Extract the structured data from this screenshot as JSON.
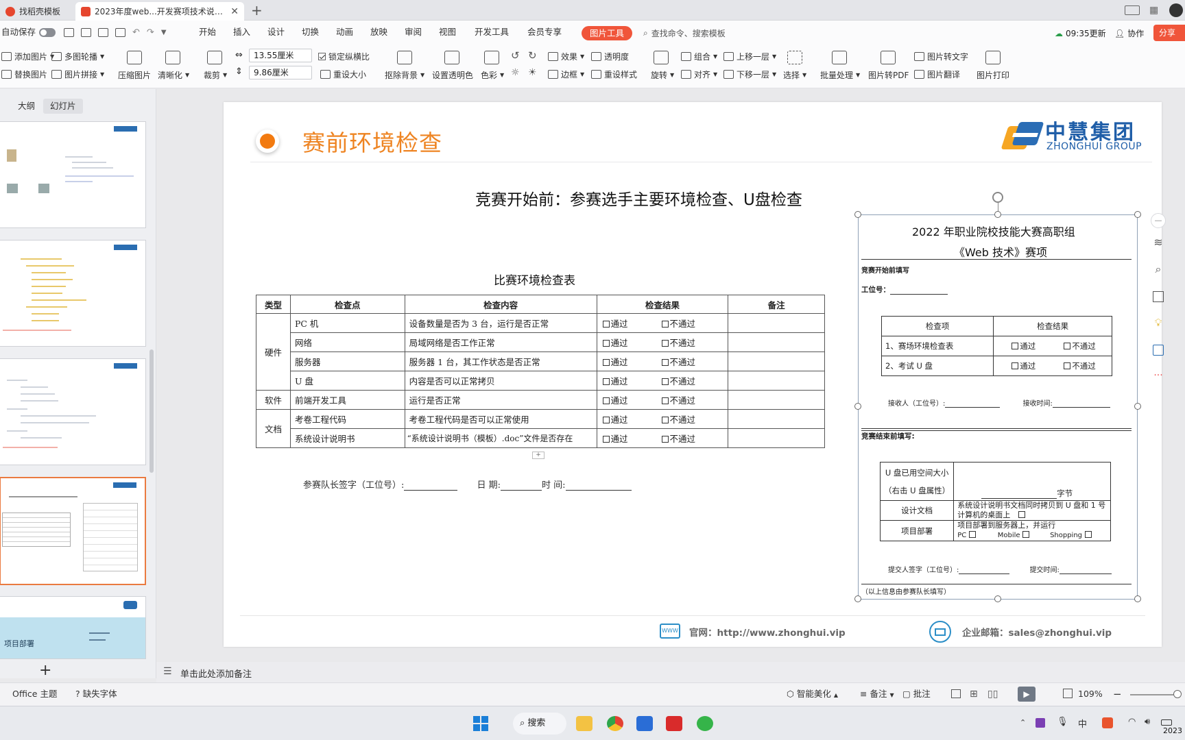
{
  "tabs": [
    {
      "label": "找稻壳模板",
      "color": "#e6462e"
    },
    {
      "label": "2023年度web...开发赛项技术说明会",
      "color": "#e6462e"
    }
  ],
  "menu": {
    "autosave": "自动保存",
    "items": [
      "开始",
      "插入",
      "设计",
      "切换",
      "动画",
      "放映",
      "审阅",
      "视图",
      "开发工具",
      "会员专享"
    ],
    "picture_tools": "图片工具",
    "search_placeholder": "查找命令、搜索模板",
    "update_time": "09:35更新",
    "collab": "协作",
    "share": "分享"
  },
  "ribbon": {
    "add_picture": "添加图片",
    "multi_carousel": "多图轮播",
    "replace_picture": "替换图片",
    "picture_stitch": "图片拼接",
    "compress": "压缩图片",
    "clarify": "清晰化",
    "crop": "裁剪",
    "width": "13.55厘米",
    "height": "9.86厘米",
    "lock_ratio": "锁定纵横比",
    "reset_size": "重设大小",
    "remove_bg": "抠除背景",
    "set_transparent": "设置透明色",
    "color": "色彩",
    "effect": "效果",
    "transparency": "透明度",
    "border": "边框",
    "reset_style": "重设样式",
    "rotate": "旋转",
    "group": "组合",
    "align": "对齐",
    "bring_forward": "上移一层",
    "send_backward": "下移一层",
    "select": "选择",
    "batch": "批量处理",
    "to_pdf": "图片转PDF",
    "to_text": "图片转文字",
    "translate": "图片翻译",
    "print": "图片打印"
  },
  "left_panel": {
    "tab_outline": "大纲",
    "tab_slides": "幻灯片",
    "slide_numbers": [
      "",
      "",
      "",
      "",
      ""
    ],
    "thumb5_text": "项目部署",
    "add_slide": "+"
  },
  "slide": {
    "title": "赛前环境检查",
    "logo_cn": "中慧集团",
    "logo_en": "ZHONGHUI GROUP",
    "headline": "竞赛开始前：参赛选手主要环境检查、U盘检查",
    "table_title": "比赛环境检查表",
    "table_headers": [
      "类型",
      "检查点",
      "检查内容",
      "检查结果",
      "备注"
    ],
    "rows": [
      {
        "type": "",
        "point": "PC 机",
        "content": "设备数量是否为 3 台，运行是否正常"
      },
      {
        "type": "硬件",
        "point": "网络",
        "content": "局域网络是否工作正常"
      },
      {
        "type": "",
        "point": "服务器",
        "content": "服务器 1 台，其工作状态是否正常"
      },
      {
        "type": "",
        "point": "U 盘",
        "content": "内容是否可以正常拷贝"
      },
      {
        "type": "软件",
        "point": "前端开发工具",
        "content": "运行是否正常"
      },
      {
        "type": "文档",
        "point": "考卷工程代码",
        "content": "考卷工程代码是否可以正常使用"
      },
      {
        "type": "",
        "point": "系统设计说明书",
        "content": "“系统设计说明书（模板）.doc”文件是否存在"
      }
    ],
    "pass": "通过",
    "fail": "不通过",
    "signature_label": "参赛队长签字（工位号）:",
    "date_label": "日 期:",
    "time_label": "时 间:",
    "website_label": "官网：http://www.zhonghui.vip",
    "email_label": "企业邮箱：sales@zhonghui.vip",
    "www_icon_text": "WWW"
  },
  "panel": {
    "title1": "2022 年职业院校技能大赛高职组",
    "title2": "《Web 技术》赛项",
    "before_label": "竞赛开始前填写",
    "station_label": "工位号：",
    "mini_headers": [
      "检查项",
      "检查结果"
    ],
    "mini_rows": [
      "1、赛场环境检查表",
      "2、考试 U 盘"
    ],
    "receiver": "接收人（工位号）:",
    "receive_time": "接收时间:",
    "after_label": "竞赛结束前填写:",
    "udisk_label1": "U 盘已用空间大小",
    "udisk_label2": "（右击 U 盘属性）",
    "bytes": "字节",
    "design_doc": "设计文档",
    "design_doc_text1": "系统设计说明书文档同时拷贝到 U 盘和 1 号",
    "design_doc_text2": "计算机的桌面上",
    "deploy": "项目部署",
    "deploy_text": "项目部署到服务器上，并运行",
    "deploy_pc": "PC",
    "deploy_mobile": "Mobile",
    "deploy_shopping": "Shopping",
    "submitter": "提交人签字（工位号）:",
    "submit_time": "提交时间:",
    "footnote": "（以上信息由参赛队长填写）"
  },
  "notes": {
    "placeholder": "单击此处添加备注"
  },
  "status": {
    "theme": "Office 主题",
    "missing_font": "缺失字体",
    "smart": "智能美化",
    "notes": "备注",
    "comments": "批注",
    "zoom": "109%"
  },
  "taskbar": {
    "search": "搜索",
    "ime": "中",
    "year": "2023"
  }
}
